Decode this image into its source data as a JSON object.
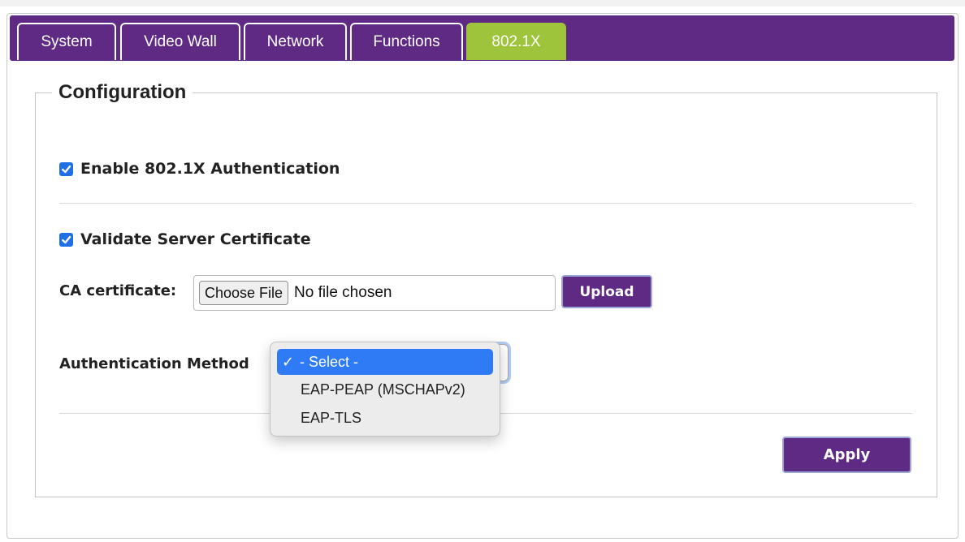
{
  "tabs": [
    {
      "label": "System"
    },
    {
      "label": "Video Wall"
    },
    {
      "label": "Network"
    },
    {
      "label": "Functions"
    },
    {
      "label": "802.1X"
    }
  ],
  "active_tab": "802.1X",
  "config": {
    "legend": "Configuration",
    "enable_8021x": {
      "label": "Enable 802.1X Authentication",
      "checked": true
    },
    "validate_cert": {
      "label": "Validate Server Certificate",
      "checked": true
    },
    "ca_cert": {
      "label": "CA certificate:",
      "choose_button": "Choose File",
      "file_status": "No file chosen",
      "upload_button": "Upload"
    },
    "auth_method": {
      "label": "Authentication Method",
      "selected": "- Select -",
      "options": [
        "- Select -",
        "EAP-PEAP (MSCHAPv2)",
        "EAP-TLS"
      ]
    },
    "apply_button": "Apply"
  },
  "colors": {
    "tab_bar": "#5e2a84",
    "active_tab": "#9dc43a",
    "selected_option": "#2f7bf5",
    "checkbox": "#1f6fe6"
  }
}
